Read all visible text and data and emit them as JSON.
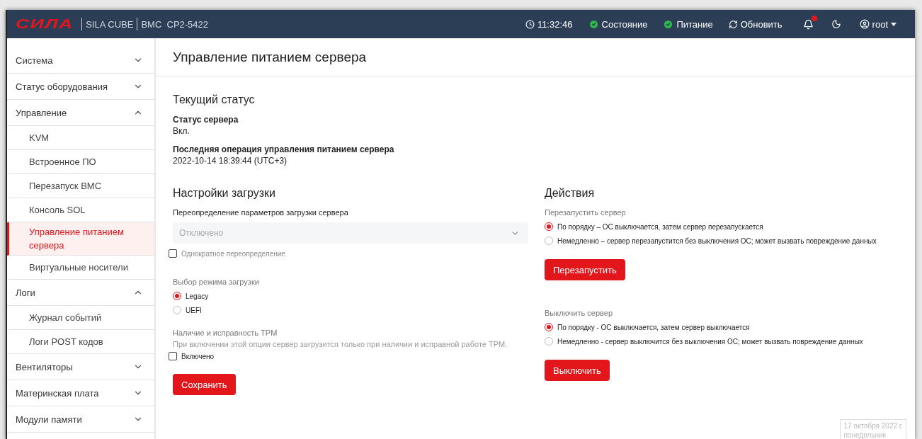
{
  "header": {
    "logo": "СИЛА",
    "product": "SILA CUBE",
    "model": "BMC  CP2-5422",
    "time": "11:32:46",
    "status_items": [
      {
        "label": "Состояние",
        "ok": true
      },
      {
        "label": "Питание",
        "ok": true
      }
    ],
    "refresh": "Обновить",
    "notification_unread": true,
    "user": "root"
  },
  "sidebar": {
    "items": [
      {
        "label": "Система",
        "expanded": false
      },
      {
        "label": "Статус оборудования",
        "expanded": false
      },
      {
        "label": "Управление",
        "expanded": true,
        "children": [
          {
            "label": "KVM",
            "selected": false
          },
          {
            "label": "Встроенное ПО",
            "selected": false
          },
          {
            "label": "Перезапуск BMC",
            "selected": false
          },
          {
            "label": "Консоль SOL",
            "selected": false
          },
          {
            "label": "Управление питанием сервера",
            "selected": true
          },
          {
            "label": "Виртуальные носители",
            "selected": false
          }
        ]
      },
      {
        "label": "Логи",
        "expanded": true,
        "children": [
          {
            "label": "Журнал событий",
            "selected": false
          },
          {
            "label": "Логи POST кодов",
            "selected": false
          }
        ]
      },
      {
        "label": "Вентиляторы",
        "expanded": false
      },
      {
        "label": "Материнская плата",
        "expanded": false
      },
      {
        "label": "Модули памяти",
        "expanded": false
      }
    ]
  },
  "page_title": "Управление питанием сервера",
  "current_status": {
    "title": "Текущий статус",
    "fields": [
      {
        "label": "Статус сервера",
        "value": "Вкл."
      },
      {
        "label": "Последняя операция управления питанием сервера",
        "value": "2022-10-14 18:39:44 (UTC+3)"
      }
    ]
  },
  "boot_settings": {
    "title": "Настройки загрузки",
    "override_label": "Переопределение параметров загрузки сервера",
    "override_value": "Отключено",
    "override_disabled": true,
    "one_time": {
      "label": "Однократное переопределение",
      "checked": false,
      "disabled": true
    },
    "mode_label": "Выбор режима загрузки",
    "modes": [
      {
        "label": "Legacy",
        "selected": true
      },
      {
        "label": "UEFI",
        "selected": false
      }
    ],
    "tpm_label": "Наличие и исправность TPM",
    "tpm_hint": "При включении этой опции сервер загрузится только при наличии и исправной работе TPM.",
    "tpm_enabled": {
      "label": "Включено",
      "checked": false,
      "disabled": false
    },
    "save": "Сохранить"
  },
  "actions": {
    "title": "Действия",
    "groups": [
      {
        "label": "Перезапустить сервер",
        "options": [
          {
            "label": "По порядку – ОС выключается, затем сервер перезапускается",
            "selected": true
          },
          {
            "label": "Немедленно – сервер перезапустится без выключения ОС; может вызвать повреждение данных",
            "selected": false
          }
        ],
        "button": "Перезапустить"
      },
      {
        "label": "Выключить сервер",
        "options": [
          {
            "label": "По порядку - ОС выключается, затем сервер выключается",
            "selected": true
          },
          {
            "label": "Немедленно - сервер выключится без выключения ОС; может вызвать повреждение данных",
            "selected": false
          }
        ],
        "button": "Выключить"
      }
    ]
  },
  "date_tooltip": {
    "date": "17 октября 2022 г.",
    "weekday": "понедельник"
  }
}
